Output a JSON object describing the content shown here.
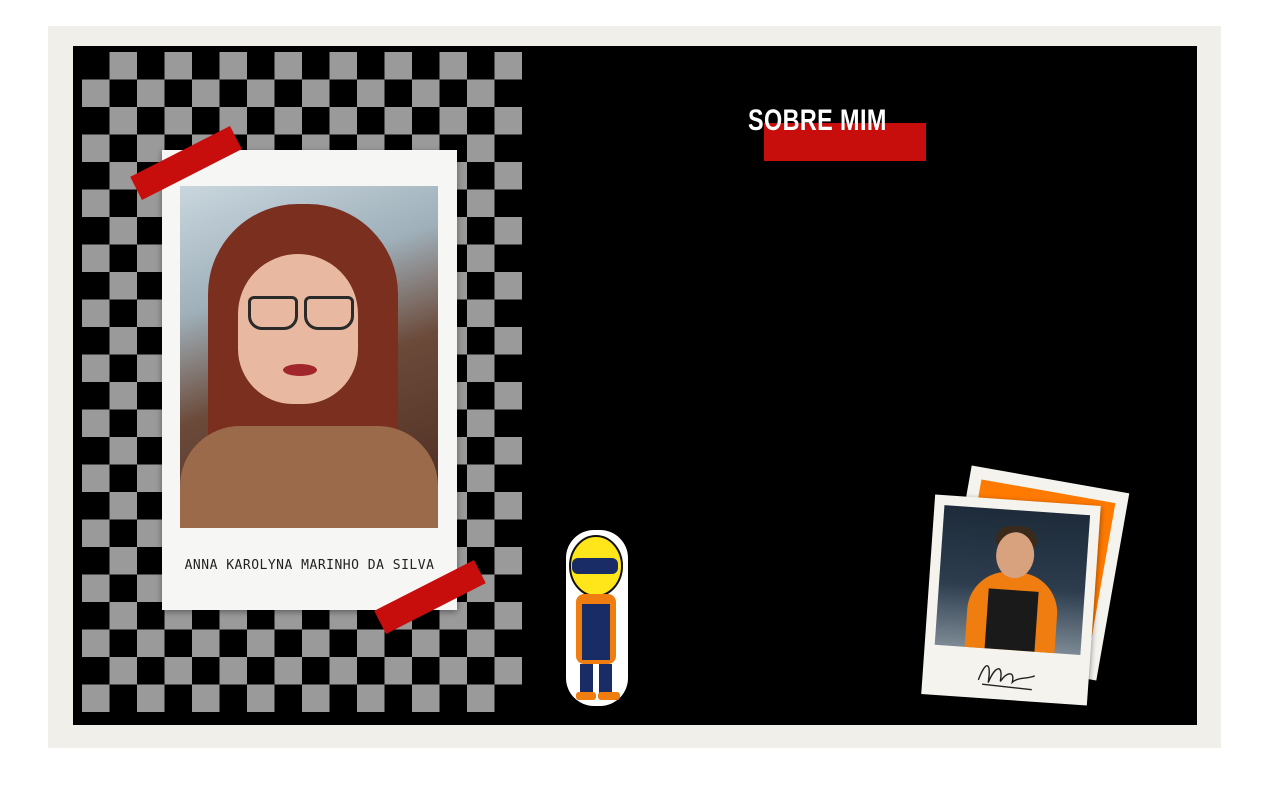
{
  "slide": {
    "title": "SOBRE MIM",
    "caption": "ANNA KAROLYNA MARINHO DA SILVA"
  },
  "colors": {
    "background": "#000000",
    "frame": "#f0efea",
    "accent_red": "#c80d0d",
    "checker_gray": "#9a9a9a",
    "orange": "#ff7a00"
  },
  "images": {
    "portrait": "portrait-photo",
    "driver_sticker": "driver-cartoon-sticker",
    "driver_polaroid": "driver-polaroid-photo"
  }
}
